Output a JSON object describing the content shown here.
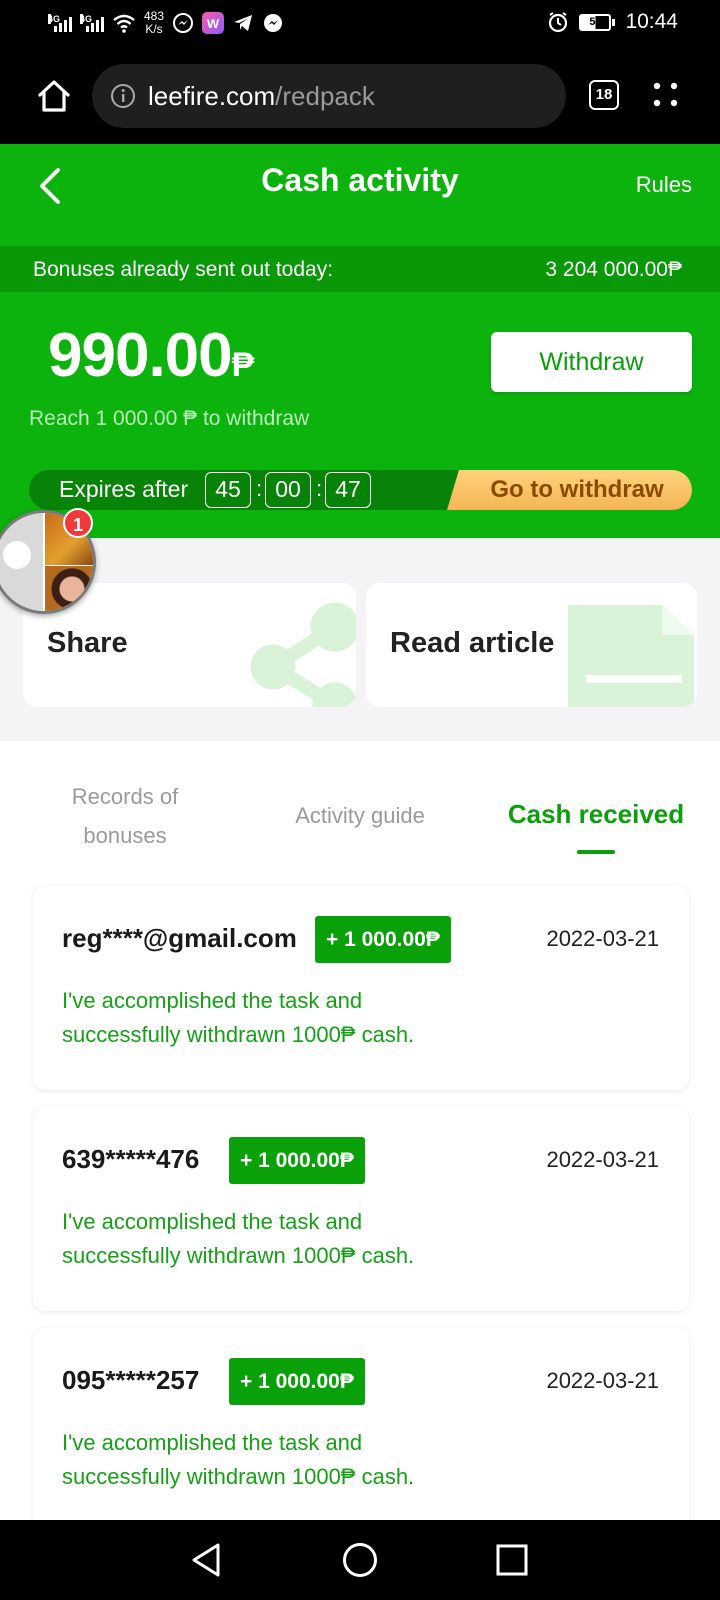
{
  "status_bar": {
    "net1": "4G",
    "net2": "4G",
    "speed_value": "483",
    "speed_unit": "K/s",
    "app_icons": [
      "messenger-icon",
      "w-app-icon",
      "telegram-icon",
      "messenger-icon"
    ],
    "battery": "51",
    "time": "10:44"
  },
  "browser": {
    "domain": "leefire.com",
    "path": "/redpack",
    "tab_count": "18"
  },
  "header": {
    "title": "Cash activity",
    "rules_label": "Rules"
  },
  "bonus_strip": {
    "label": "Bonuses already sent out today:",
    "value": "3 204 000.00₱"
  },
  "balance": {
    "amount": "990.00",
    "currency": "₱",
    "reach_text": "Reach 1 000.00 ₱ to withdraw",
    "withdraw_label": "Withdraw"
  },
  "expire": {
    "label": "Expires after",
    "hours": "45",
    "minutes": "00",
    "seconds": "47",
    "sep": ":",
    "goto_label": "Go to withdraw"
  },
  "chat_bubble": {
    "badge_count": "1"
  },
  "tasks": [
    {
      "label": "Share",
      "icon": "share-icon"
    },
    {
      "label": "Read article",
      "icon": "document-icon"
    }
  ],
  "tabs": {
    "records_line1": "Records of",
    "records_line2": "bonuses",
    "guide": "Activity guide",
    "received": "Cash received"
  },
  "records": [
    {
      "user": "reg****@gmail.com",
      "amount": "+ 1 000.00₱",
      "date": "2022-03-21",
      "message": "I've accomplished the task and successfully withdrawn 1000₱ cash."
    },
    {
      "user": "639*****476",
      "amount": "+ 1 000.00₱",
      "date": "2022-03-21",
      "message": "I've accomplished the task and successfully withdrawn 1000₱ cash."
    },
    {
      "user": "095*****257",
      "amount": "+ 1 000.00₱",
      "date": "2022-03-21",
      "message": "I've accomplished the task and successfully withdrawn 1000₱ cash."
    }
  ],
  "colors": {
    "brand_green": "#0db30d",
    "dark_green": "#089808",
    "accent_text_green": "#0aa00a",
    "gold_button": "#f5b555"
  }
}
